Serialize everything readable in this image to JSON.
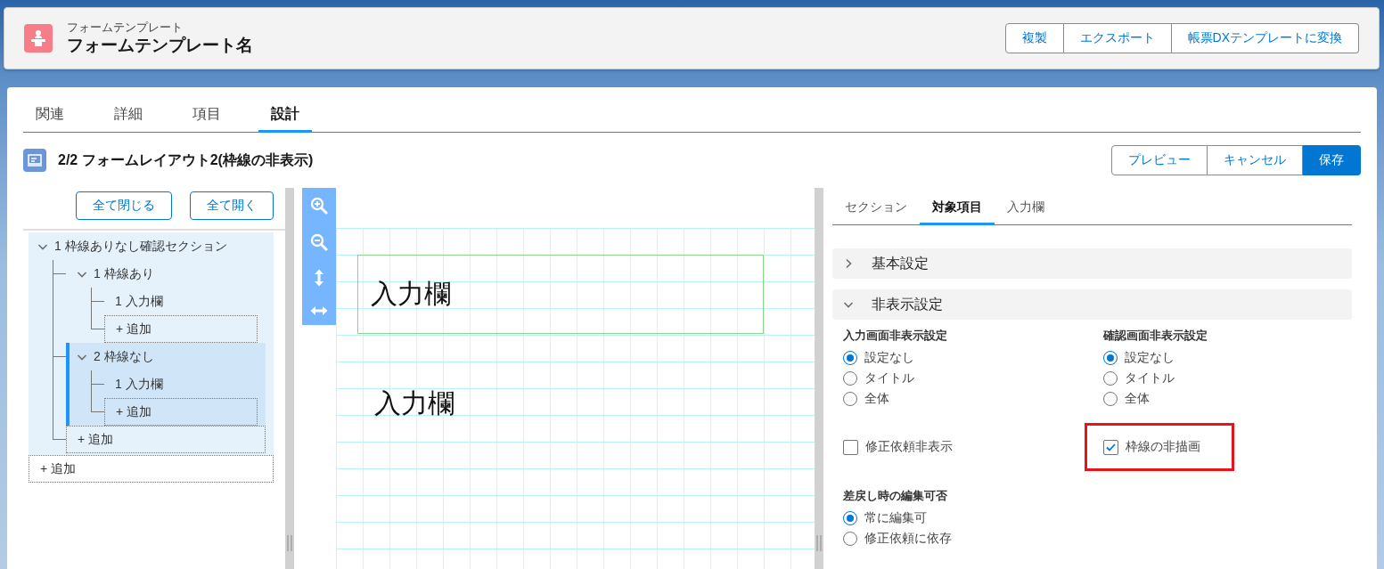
{
  "header": {
    "object_type": "フォームテンプレート",
    "title": "フォームテンプレート名",
    "actions": [
      "複製",
      "エクスポート",
      "帳票DXテンプレートに変換"
    ]
  },
  "tabs": [
    {
      "label": "関連",
      "selected": false
    },
    {
      "label": "詳細",
      "selected": false
    },
    {
      "label": "項目",
      "selected": false
    },
    {
      "label": "設計",
      "selected": true
    }
  ],
  "layout": {
    "title": "2/2 フォームレイアウト2(枠線の非表示)",
    "actions": [
      {
        "label": "プレビュー",
        "kind": "neutral"
      },
      {
        "label": "キャンセル",
        "kind": "neutral"
      },
      {
        "label": "保存",
        "kind": "brand"
      }
    ]
  },
  "tree": {
    "collapse_all": "全て閉じる",
    "expand_all": "全て開く",
    "items": [
      {
        "kind": "node",
        "label": "1 枠線ありなし確認セクション",
        "expanded": true,
        "selected": false,
        "children": [
          {
            "kind": "node",
            "label": "1 枠線あり",
            "expanded": true,
            "selected": false,
            "children": [
              {
                "kind": "leaf",
                "label": "1 入力欄",
                "selected": false
              },
              {
                "kind": "add",
                "label": "+ 追加"
              }
            ]
          },
          {
            "kind": "node",
            "label": "2 枠線なし",
            "expanded": true,
            "selected": true,
            "children": [
              {
                "kind": "leaf",
                "label": "1 入力欄",
                "selected": false
              },
              {
                "kind": "add",
                "label": "+ 追加"
              }
            ]
          },
          {
            "kind": "add",
            "label": "+ 追加"
          }
        ]
      },
      {
        "kind": "add",
        "label": "+ 追加"
      }
    ]
  },
  "canvas": {
    "fields": [
      {
        "label": "入力欄",
        "bordered": true
      },
      {
        "label": "入力欄",
        "bordered": false
      }
    ]
  },
  "properties": {
    "tabs": [
      {
        "label": "セクション",
        "selected": false
      },
      {
        "label": "対象項目",
        "selected": true
      },
      {
        "label": "入力欄",
        "selected": false
      }
    ],
    "sections": [
      {
        "title": "基本設定",
        "expanded": false
      },
      {
        "title": "非表示設定",
        "expanded": true,
        "radio_groups": [
          {
            "label": "入力画面非表示設定",
            "options": [
              {
                "label": "設定なし",
                "selected": true
              },
              {
                "label": "タイトル",
                "selected": false
              },
              {
                "label": "全体",
                "selected": false
              }
            ]
          },
          {
            "label": "確認画面非表示設定",
            "options": [
              {
                "label": "設定なし",
                "selected": true
              },
              {
                "label": "タイトル",
                "selected": false
              },
              {
                "label": "全体",
                "selected": false
              }
            ]
          },
          {
            "label": "差戻し時の編集可否",
            "options": [
              {
                "label": "常に編集可",
                "selected": true
              },
              {
                "label": "修正依頼に依存",
                "selected": false
              }
            ]
          }
        ],
        "checkboxes": [
          {
            "label": "修正依頼非表示",
            "checked": false,
            "highlighted": false
          },
          {
            "label": "枠線の非描画",
            "checked": true,
            "highlighted": true
          }
        ]
      }
    ]
  }
}
